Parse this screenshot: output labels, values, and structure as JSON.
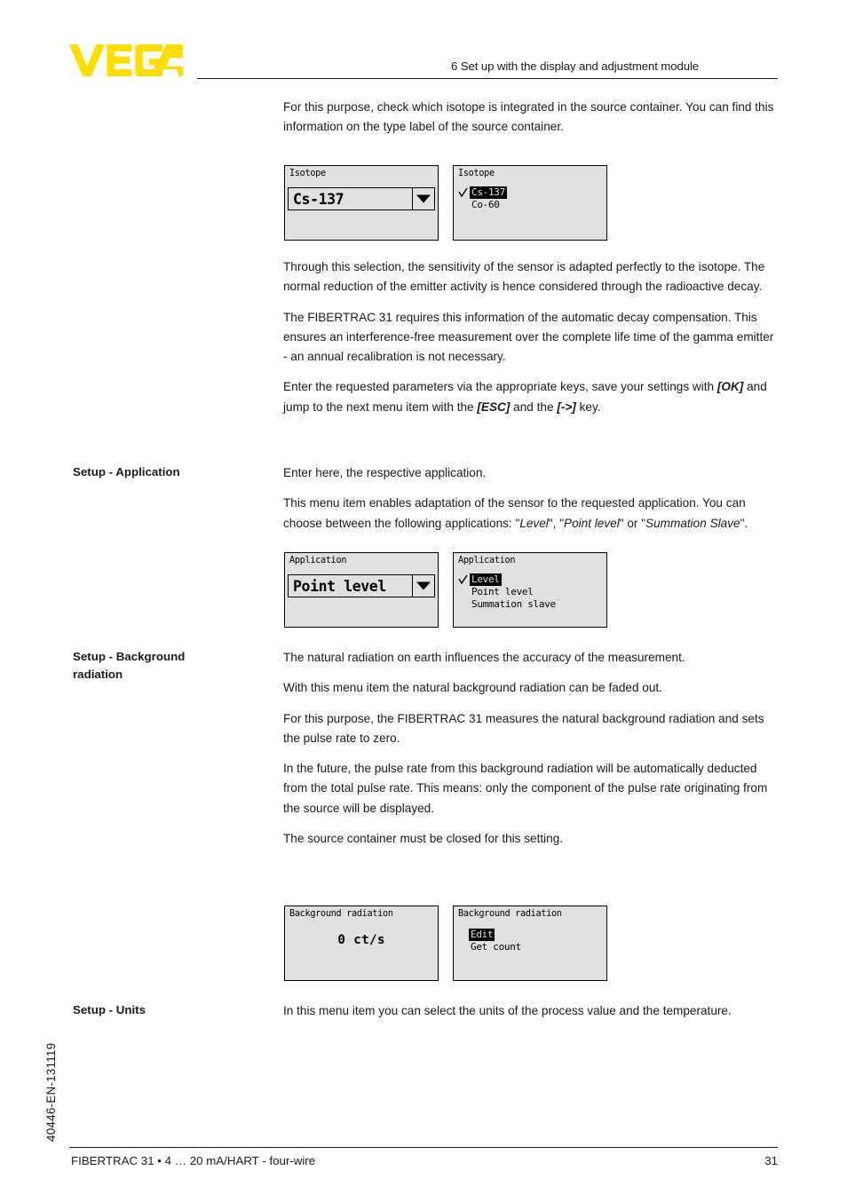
{
  "brand": {
    "logo_text": "VEGA",
    "logo_color": "#FFDD00"
  },
  "header": {
    "chapter_title": "6 Set up with the display and adjustment module"
  },
  "doc_number": "40446-EN-131119",
  "footer": {
    "left": "FIBERTRAC 31 • 4 … 20 mA/HART - four-wire",
    "page": "31"
  },
  "sections": [
    {
      "id": "isotope",
      "label": "",
      "paragraphs": [
        "For this purpose, check which isotope is integrated in the source container. You can find this information on the type label of the source container."
      ],
      "after_paragraphs": [
        "Through this selection, the sensitivity of the sensor is adapted perfectly to the isotope. The normal reduction of the emitter activity is hence considered through the radioactive decay.",
        "The FIBERTRAC 31 requires this information of the automatic decay compensation. This ensures an interference-free measurement over the complete life time of the gamma emitter - an annual recalibration is not necessary."
      ]
    }
  ],
  "para_isotope_intro": "For this purpose, check which isotope is integrated in the source container. You can find this information on the type label of the source container.",
  "para_isotope_1": "Through this selection, the sensitivity of the sensor is adapted perfectly to the isotope. The normal reduction of the emitter activity is hence considered through the radioactive decay.",
  "para_isotope_2": "The FIBERTRAC 31 requires this information of the automatic decay compensation. This ensures an interference-free measurement over the complete life time of the gamma emitter - an annual recalibration is not necessary.",
  "para_keys": {
    "before_ok": "Enter the requested parameters via the appropriate keys, save your settings with ",
    "key_ok": "[OK]",
    "mid": " and jump to the next menu item with the ",
    "key_esc": "[ESC]",
    "after_esc": " and the ",
    "key_arrow": "[->]",
    "tail": " key."
  },
  "setup_application": {
    "label": "Setup - Application",
    "para_1": "Enter here, the respective application.",
    "para_2_before": "This menu item enables adaptation of the sensor to the requested application. You can choose between the following applications: \"",
    "opt_level": "Level",
    "para_2_mid1": "\", \"",
    "opt_point_level": "Point level",
    "para_2_mid2": "\" or \"",
    "opt_summation_slave": "Summation Slave",
    "para_2_tail": "\"."
  },
  "setup_background": {
    "label_line1": "Setup - Background",
    "label_line2": "radiation",
    "para_1": "The natural radiation on earth influences the accuracy of the measurement.",
    "para_2": "With this menu item the natural background radiation can be faded out.",
    "para_3": "For this purpose, the FIBERTRAC 31 measures the natural background radiation and sets the pulse rate to zero.",
    "para_4": "In the future, the pulse rate from this background radiation will be automatically deducted from the total pulse rate. This means: only the component of the pulse rate originating from the source will be displayed.",
    "para_5": "The source container must be closed for this setting."
  },
  "setup_units": {
    "label": "Setup - Units",
    "para_1": "In this menu item you can select the units of the process value and the temperature."
  },
  "lcd_screens": {
    "isotope_value": {
      "title": "Isotope",
      "value": "Cs-137",
      "dropdown_icon": "chevron-down-icon"
    },
    "isotope_list": {
      "title": "Isotope",
      "items": [
        {
          "label": "Cs-137",
          "selected": true,
          "checked": true
        },
        {
          "label": "Co-60",
          "selected": false,
          "checked": false
        }
      ]
    },
    "application_value": {
      "title": "Application",
      "value": "Point level",
      "dropdown_icon": "chevron-down-icon"
    },
    "application_list": {
      "title": "Application",
      "items": [
        {
          "label": "Level",
          "selected": true,
          "checked": true
        },
        {
          "label": "Point level",
          "selected": false,
          "checked": false
        },
        {
          "label": "Summation slave",
          "selected": false,
          "checked": false
        }
      ]
    },
    "background_value": {
      "title": "Background radiation",
      "value": "0 ct/s"
    },
    "background_list": {
      "title": "Background radiation",
      "items": [
        {
          "label": "Edit",
          "selected": true,
          "checked": false
        },
        {
          "label": "Get count",
          "selected": false,
          "checked": false
        }
      ]
    }
  }
}
